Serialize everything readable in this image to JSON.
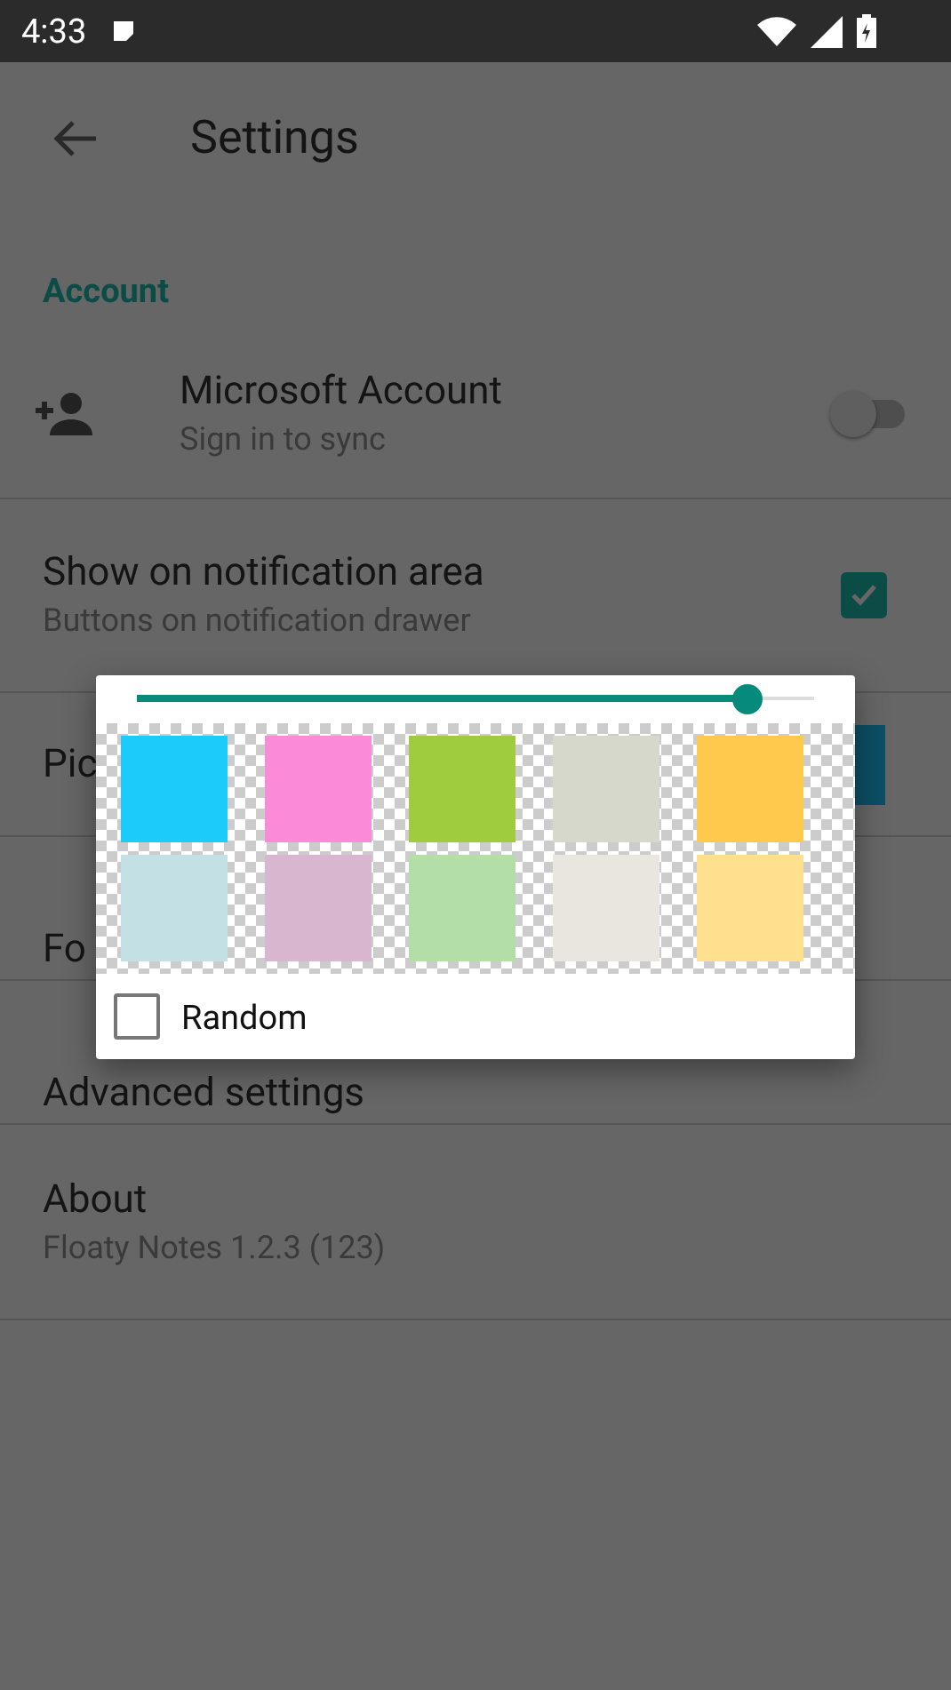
{
  "status_bar": {
    "time": "4:33"
  },
  "toolbar": {
    "title": "Settings"
  },
  "settings": [
    {
      "kind": "header",
      "title": "Account"
    },
    {
      "kind": "switch",
      "title": "Microsoft Account",
      "subtitle": "Sign in to sync",
      "on": false
    },
    {
      "kind": "checkbox",
      "title": "Show on notification area",
      "subtitle": "Buttons on notification drawer",
      "checked": true
    },
    {
      "kind": "color",
      "title": "Pic",
      "color": "#0c4f64"
    },
    {
      "kind": "plain",
      "title": "Fo"
    },
    {
      "kind": "plain",
      "title": "Advanced settings"
    },
    {
      "kind": "plain",
      "title": "About",
      "subtitle": "Floaty Notes 1.2.3 (123)"
    }
  ],
  "color_dialog": {
    "slider": {
      "level": 0.9
    },
    "swatches": [
      {
        "color": "#1ccbf9"
      },
      {
        "color": "#f98bd9"
      },
      {
        "color": "#9fcc3e"
      },
      {
        "color": "#d6d8cc"
      },
      {
        "color": "#ffc94d"
      },
      {
        "color": "#c3e0e4"
      },
      {
        "color": "#d9b6cf"
      },
      {
        "color": "#b3dea8"
      },
      {
        "color": "#e9e6df"
      },
      {
        "color": "#ffe08e"
      }
    ],
    "random": {
      "label": "Random",
      "checked": false
    }
  }
}
